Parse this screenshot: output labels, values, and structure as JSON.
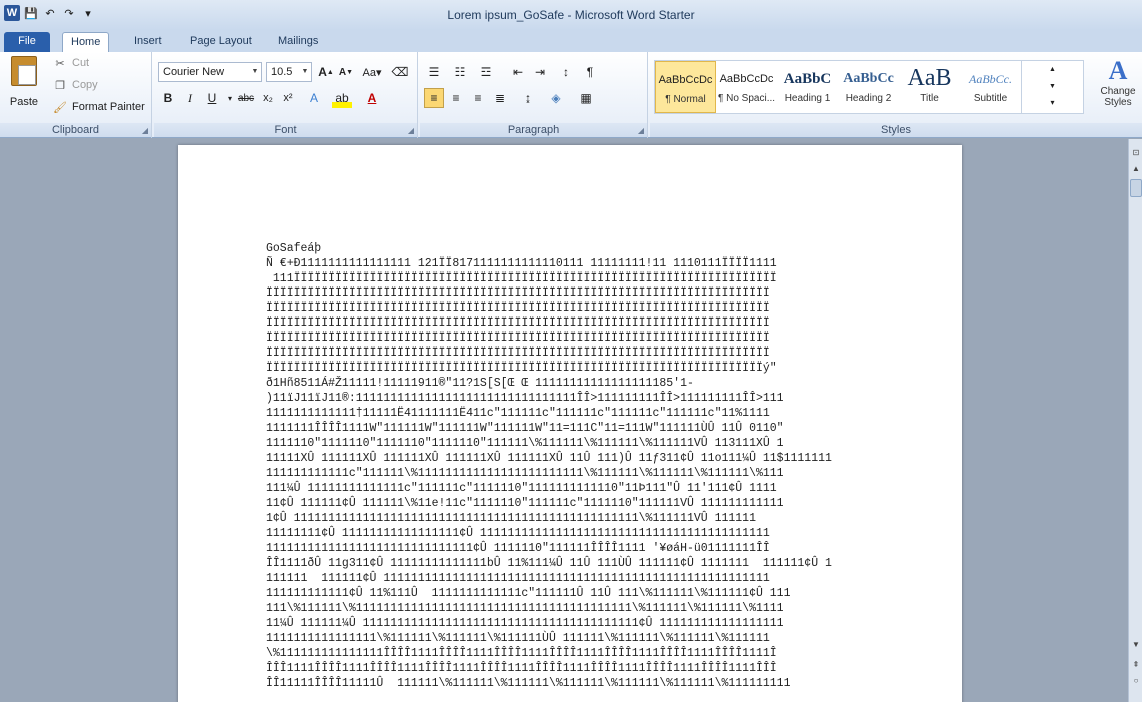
{
  "window": {
    "title": "Lorem ipsum_GoSafe - Microsoft Word Starter"
  },
  "qat": {
    "logo": "W",
    "save": "💾",
    "undo": "↶",
    "redo": "↷",
    "customize": "▾"
  },
  "tabs": [
    "File",
    "Home",
    "Insert",
    "Page Layout",
    "Mailings"
  ],
  "clipboard": {
    "paste": "Paste",
    "cut": "Cut",
    "copy": "Copy",
    "format_painter": "Format Painter",
    "label": "Clipboard"
  },
  "font": {
    "family": "Courier New",
    "size": "10.5",
    "label": "Font"
  },
  "paragraph": {
    "label": "Paragraph"
  },
  "styles": {
    "label": "Styles",
    "items": [
      {
        "preview": "AaBbCcDc",
        "name": "¶ Normal"
      },
      {
        "preview": "AaBbCcDc",
        "name": "¶ No Spaci..."
      },
      {
        "preview": "AaBbC",
        "name": "Heading 1"
      },
      {
        "preview": "AaBbCc",
        "name": "Heading 2"
      },
      {
        "preview": "AaB",
        "name": "Title"
      },
      {
        "preview": "AaBbCc.",
        "name": "Subtitle"
      }
    ],
    "change_styles": "Change Styles"
  },
  "document": {
    "lines": [
      "GoSafeáþ",
      "Ñ €+Ð1111111111111111 121ÏÏ8171111111111110111 11111111!11 1110111ÏÏÏÏ1111",
      " 111ÏÏÏÏÏÏÏÏÏÏÏÏÏÏÏÏÏÏÏÏÏÏÏÏÏÏÏÏÏÏÏÏÏÏÏÏÏÏÏÏÏÏÏÏÏÏÏÏÏÏÏÏÏÏÏÏÏÏÏÏÏÏÏÏÏÏÏÏÏÏ",
      "ÏÏÏÏÏÏÏÏÏÏÏÏÏÏÏÏÏÏÏÏÏÏÏÏÏÏÏÏÏÏÏÏÏÏÏÏÏÏÏÏÏÏÏÏÏÏÏÏÏÏÏÏÏÏÏÏÏÏÏÏÏÏÏÏÏÏÏÏÏÏÏÏÏ",
      "ÏÏÏÏÏÏÏÏÏÏÏÏÏÏÏÏÏÏÏÏÏÏÏÏÏÏÏÏÏÏÏÏÏÏÏÏÏÏÏÏÏÏÏÏÏÏÏÏÏÏÏÏÏÏÏÏÏÏÏÏÏÏÏÏÏÏÏÏÏÏÏÏÏ",
      "ÏÏÏÏÏÏÏÏÏÏÏÏÏÏÏÏÏÏÏÏÏÏÏÏÏÏÏÏÏÏÏÏÏÏÏÏÏÏÏÏÏÏÏÏÏÏÏÏÏÏÏÏÏÏÏÏÏÏÏÏÏÏÏÏÏÏÏÏÏÏÏÏÏ",
      "ÏÏÏÏÏÏÏÏÏÏÏÏÏÏÏÏÏÏÏÏÏÏÏÏÏÏÏÏÏÏÏÏÏÏÏÏÏÏÏÏÏÏÏÏÏÏÏÏÏÏÏÏÏÏÏÏÏÏÏÏÏÏÏÏÏÏÏÏÏÏÏÏÏ",
      "ÏÏÏÏÏÏÏÏÏÏÏÏÏÏÏÏÏÏÏÏÏÏÏÏÏÏÏÏÏÏÏÏÏÏÏÏÏÏÏÏÏÏÏÏÏÏÏÏÏÏÏÏÏÏÏÏÏÏÏÏÏÏÏÏÏÏÏÏÏÏÏÏÏ",
      "ÏÏÏÏÏÏÏÏÏÏÏÏÏÏÏÏÏÏÏÏÏÏÏÏÏÏÏÏÏÏÏÏÏÏÏÏÏÏÏÏÏÏÏÏÏÏÏÏÏÏÏÏÏÏÏÏÏÏÏÏÏÏÏÏÏÏÏÏÏÏÏÏý\"",
      "ð1Hñ8511Á#Ž11111!11111911®\"11?1S[S[Œ Œ 11111111111111111185'1-",
      ")11ïJ11ïJ11®:11111111111111111111111111111111ÎÎ>111111111ÎÎ>111111111ÎÎ>111",
      "1111111111111†11111Ë41111111Ë411c\"111111c\"111111c\"111111c\"111111c\"11%1111",
      "1111111ÎÎÎÎ1111W\"111111W\"111111W\"111111W\"11=111C\"11=111W\"111111ÙÛ 11Û 0110\"",
      "1111110\"1111110\"1111110\"1111110\"111111\\%111111\\%111111\\%111111VÛ 113111XÛ 1",
      "11111XÛ 111111XÛ 111111XÛ 111111XÛ 111111XÛ 11Û 111)Û 11ƒ311¢Û 11o111¼Û 11$1111111",
      "111111111111c\"111111\\%111111111111111111111111\\%111111\\%111111\\%111111\\%111",
      "111¼Û 11111111111111c\"111111c\"1111110\"1111111111110\"11Þ111\"Û 11'111¢Û 1111",
      "11¢Û 111111¢Û 111111\\%11e!11c\"1111110\"111111c\"1111110\"111111VÛ 111111111111",
      "1¢Û 11111111111111111111111111111111111111111111111111\\%111111VÛ 111111",
      "11111111¢Û 11111111111111111¢Û 111111111111111111111111111111111111111111",
      "111111111111111111111111111111¢Û 1111110\"111111ÎÎÎÎ1111 '¥øáH-ü01111111ÎÎ",
      "ÎÎ1111ðÛ 11g311¢Û 11111111111111bÛ 11%111¼Û 11Û 111ÙÛ 111111¢Û 1111111  111111¢Û 1",
      "111111  111111¢Û 11111111111111111111111111111111111111111111111111111111",
      "111111111111¢Û 11%111Û  1111111111111c\"111111Û 11Û 111\\%111111\\%111111¢Û 111",
      "111\\%111111\\%1111111111111111111111111111111111111111\\%111111\\%111111\\%1111",
      "11¼Û 111111¼Û 1111111111111111111111111111111111111111¢Û 111111111111111111",
      "1111111111111111\\%111111\\%111111\\%111111ÙÛ 111111\\%111111\\%111111\\%111111",
      "\\%111111111111111ÎÎÎÎ1111ÎÎÎÎ1111ÎÎÎÎ1111ÎÎÎÎ1111ÎÎÎÎ1111ÎÎÎÎ1111ÎÎÎÎ1111Î",
      "ÎÎÎ1111ÎÎÎÎ1111ÎÎÎÎ1111ÎÎÎÎ1111ÎÎÎÎ1111ÎÎÎÎ1111ÎÎÎÎ1111ÎÎÎÎ1111ÎÎÎÎ1111ÎÎÎ",
      "ÎÎ11111ÎÎÎÎ11111Û  111111\\%111111\\%111111\\%111111\\%111111\\%111111\\%111111111"
    ]
  }
}
